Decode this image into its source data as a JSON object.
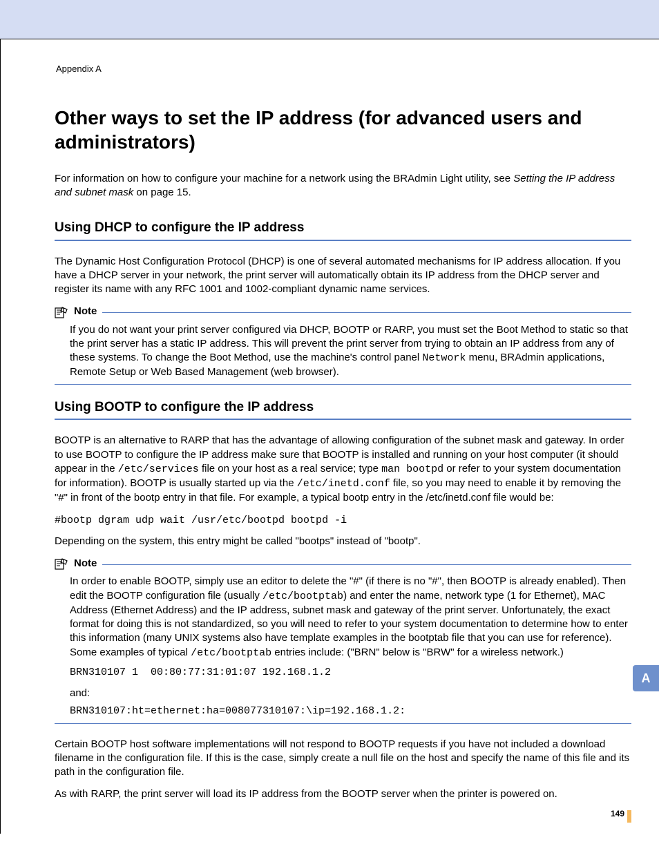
{
  "breadcrumb": "Appendix A",
  "title": "Other ways to set the IP address (for advanced users and administrators)",
  "intro_pre": "For information on how to configure your machine for a network using the BRAdmin Light utility, see ",
  "intro_ital": "Setting the IP address and subnet mask",
  "intro_post": " on page 15.",
  "dhcp": {
    "heading": "Using DHCP to configure the IP address",
    "para": "The Dynamic Host Configuration Protocol (DHCP) is one of several automated mechanisms for IP address allocation. If you have a DHCP server in your network, the print server will automatically obtain its IP address from the DHCP server and register its name with any RFC 1001 and 1002-compliant dynamic name services.",
    "note_label": "Note",
    "note_a": "If you do not want your print server configured via DHCP, BOOTP or RARP, you must set the Boot Method to static so that the print server has a static IP address. This will prevent the print server from trying to obtain an IP address from any of these systems. To change the Boot Method, use the machine's control panel ",
    "note_mono": "Network",
    "note_b": " menu, BRAdmin applications, Remote Setup or Web Based Management (web browser)."
  },
  "bootp": {
    "heading": "Using BOOTP to configure the IP address",
    "p1_a": "BOOTP is an alternative to RARP that has the advantage of allowing configuration of the subnet mask and gateway. In order to use BOOTP to configure the IP address make sure that BOOTP is installed and running on your host computer (it should appear in the ",
    "p1_m1": "/etc/services",
    "p1_b": " file on your host as a real service; type ",
    "p1_m2": "man bootpd",
    "p1_c": " or refer to your system documentation for information). BOOTP is usually started up via the ",
    "p1_m3": "/etc/inetd.conf",
    "p1_d": " file, so you may need to enable it by removing the \"#\" in front of the bootp entry in that file. For example, a typical bootp entry in the /etc/inetd.conf file would be:",
    "code1": "#bootp dgram udp wait /usr/etc/bootpd bootpd -i",
    "p2": "Depending on the system, this entry might be called \"bootps\" instead of \"bootp\".",
    "note_label": "Note",
    "note_a": "In order to enable BOOTP, simply use an editor to delete the \"#\" (if there is no \"#\", then BOOTP is already enabled). Then edit the BOOTP configuration file (usually ",
    "note_m1": "/etc/bootptab",
    "note_b": ") and enter the name, network type (1 for Ethernet), MAC Address (Ethernet Address) and the IP address, subnet mask and gateway of the print server. Unfortunately, the exact format for doing this is not standardized, so you will need to refer to your system documentation to determine how to enter this information (many UNIX systems also have template examples in the bootptab file that you can use for reference). Some examples of typical ",
    "note_m2": "/etc/bootptab",
    "note_c": " entries include: (\"BRN\" below is \"BRW\" for a wireless network.)",
    "code2": "BRN310107 1  00:80:77:31:01:07 192.168.1.2",
    "and": "and:",
    "code3": "BRN310107:ht=ethernet:ha=008077310107:\\ip=192.168.1.2:",
    "p3": "Certain BOOTP host software implementations will not respond to BOOTP requests if you have not included a download filename in the configuration file. If this is the case, simply create a null file on the host and specify the name of this file and its path in the configuration file.",
    "p4": "As with RARP, the print server will load its IP address from the BOOTP server when the printer is powered on."
  },
  "side_tab": "A",
  "page_number": "149"
}
